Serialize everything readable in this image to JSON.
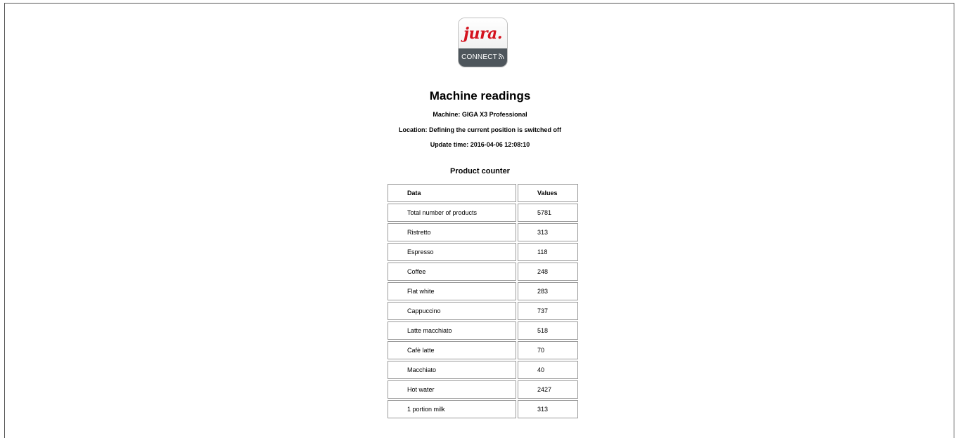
{
  "logo": {
    "brand": "jura",
    "label": "CONNECT",
    "wifi_icon": "wifi-icon",
    "brand_color": "#d4121e",
    "band_color": "#4e565c"
  },
  "header": {
    "title": "Machine readings",
    "machine": "Machine: GIGA X3 Professional",
    "location": "Location: Defining the current position is switched off",
    "update_time": "Update time: 2016-04-06 12:08:10"
  },
  "product_counter": {
    "title": "Product counter",
    "columns": [
      "Data",
      "Values"
    ],
    "rows": [
      [
        "Total number of products",
        "5781"
      ],
      [
        "Ristretto",
        "313"
      ],
      [
        "Espresso",
        "118"
      ],
      [
        "Coffee",
        "248"
      ],
      [
        "Flat white",
        "283"
      ],
      [
        "Cappuccino",
        "737"
      ],
      [
        "Latte macchiato",
        "518"
      ],
      [
        "Cafè latte",
        "70"
      ],
      [
        "Macchiato",
        "40"
      ],
      [
        "Hot water",
        "2427"
      ],
      [
        "1 portion milk",
        "313"
      ]
    ]
  }
}
